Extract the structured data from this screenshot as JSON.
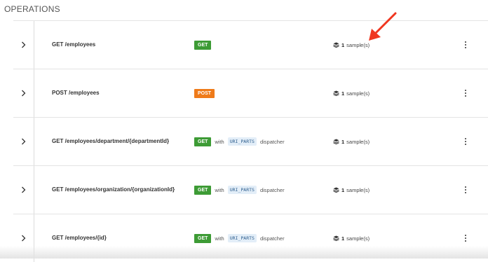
{
  "section": {
    "title": "OPERATIONS"
  },
  "operations": [
    {
      "name": "GET /employees",
      "method": "GET",
      "method_color": "#3d9b35",
      "dispatcher_prefix": "",
      "dispatcher": "",
      "dispatcher_suffix": "",
      "samples_count": "1",
      "samples_label": "sample(s)"
    },
    {
      "name": "POST /employees",
      "method": "POST",
      "method_color": "#ef7b1a",
      "dispatcher_prefix": "",
      "dispatcher": "",
      "dispatcher_suffix": "",
      "samples_count": "1",
      "samples_label": "sample(s)"
    },
    {
      "name": "GET /employees/department/{departmentId}",
      "method": "GET",
      "method_color": "#3d9b35",
      "dispatcher_prefix": "with",
      "dispatcher": "URI_PARTS",
      "dispatcher_suffix": "dispatcher",
      "samples_count": "1",
      "samples_label": "sample(s)"
    },
    {
      "name": "GET /employees/organization/{organizationId}",
      "method": "GET",
      "method_color": "#3d9b35",
      "dispatcher_prefix": "with",
      "dispatcher": "URI_PARTS",
      "dispatcher_suffix": "dispatcher",
      "samples_count": "1",
      "samples_label": "sample(s)"
    },
    {
      "name": "GET /employees/{id}",
      "method": "GET",
      "method_color": "#3d9b35",
      "dispatcher_prefix": "with",
      "dispatcher": "URI_PARTS",
      "dispatcher_suffix": "dispatcher",
      "samples_count": "1",
      "samples_label": "sample(s)"
    }
  ],
  "icons": {
    "expand": "chevron-right-icon",
    "samples": "stack-icon",
    "menu": "kebab-menu-icon",
    "annotation": "red-arrow-icon"
  },
  "colors": {
    "annotation_arrow": "#f0361f",
    "get": "#3d9b35",
    "post": "#ef7b1a"
  }
}
